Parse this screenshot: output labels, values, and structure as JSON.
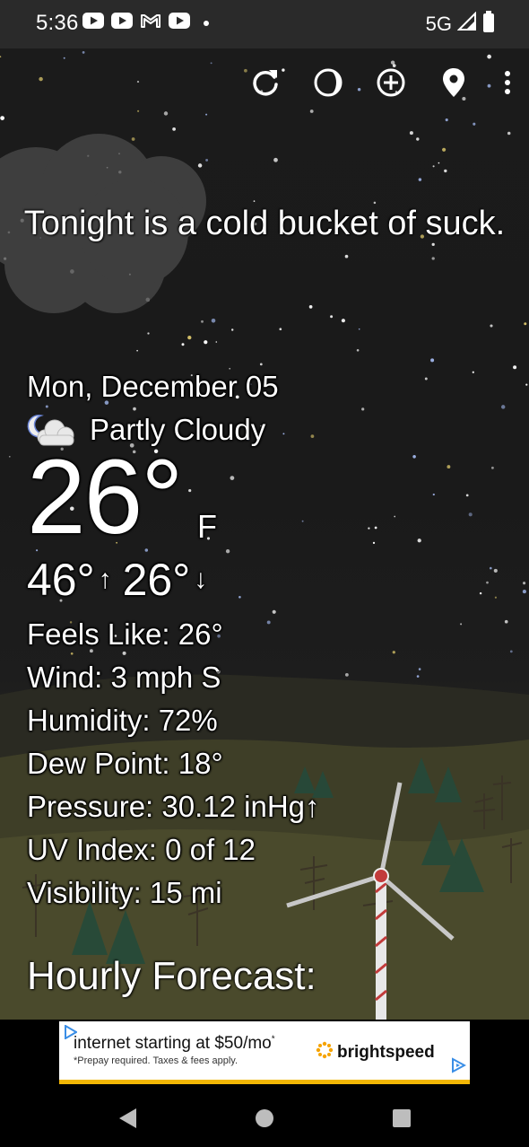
{
  "status_bar": {
    "time": "5:36",
    "notification_icons": [
      "youtube-icon",
      "youtube-icon",
      "gmail-icon",
      "youtube-icon",
      "dot-icon"
    ],
    "network": "5G",
    "signal_icon": "signal-icon",
    "battery_icon": "battery-icon"
  },
  "toolbar": {
    "icons": [
      "refresh-icon",
      "theme-icon",
      "add-location-icon",
      "location-pin-icon",
      "more-vert-icon"
    ]
  },
  "headline": "Tonight is a cold bucket of suck.",
  "weather": {
    "date": "Mon, December 05",
    "condition_icon": "partly-cloudy-night-icon",
    "condition": "Partly Cloudy",
    "temperature": "26°",
    "unit": "F",
    "high": "46°",
    "high_arrow": "↑",
    "low": "26°",
    "low_arrow": "↓",
    "details": [
      "Feels Like:  26°",
      "Wind:  3 mph S",
      "Humidity:  72%",
      "Dew Point:  18°",
      "Pressure:  30.12 inHg↑",
      "UV Index:  0 of 12",
      "Visibility:  15 mi"
    ]
  },
  "hourly_title": "Hourly Forecast:",
  "ad": {
    "headline": "internet starting at $50/mo",
    "headline_mark": "*",
    "subtext": "*Prepay required. Taxes & fees apply.",
    "brand": "brightspeed",
    "accent_color": "#f2b705",
    "adchoices_icon": "adchoices-icon"
  },
  "nav_bar": {
    "icons": [
      "back-icon",
      "home-icon",
      "recents-icon"
    ]
  },
  "colors": {
    "sky": "#1b1b1b",
    "status_bar": "#2a2a2a",
    "text": "#ffffff"
  }
}
